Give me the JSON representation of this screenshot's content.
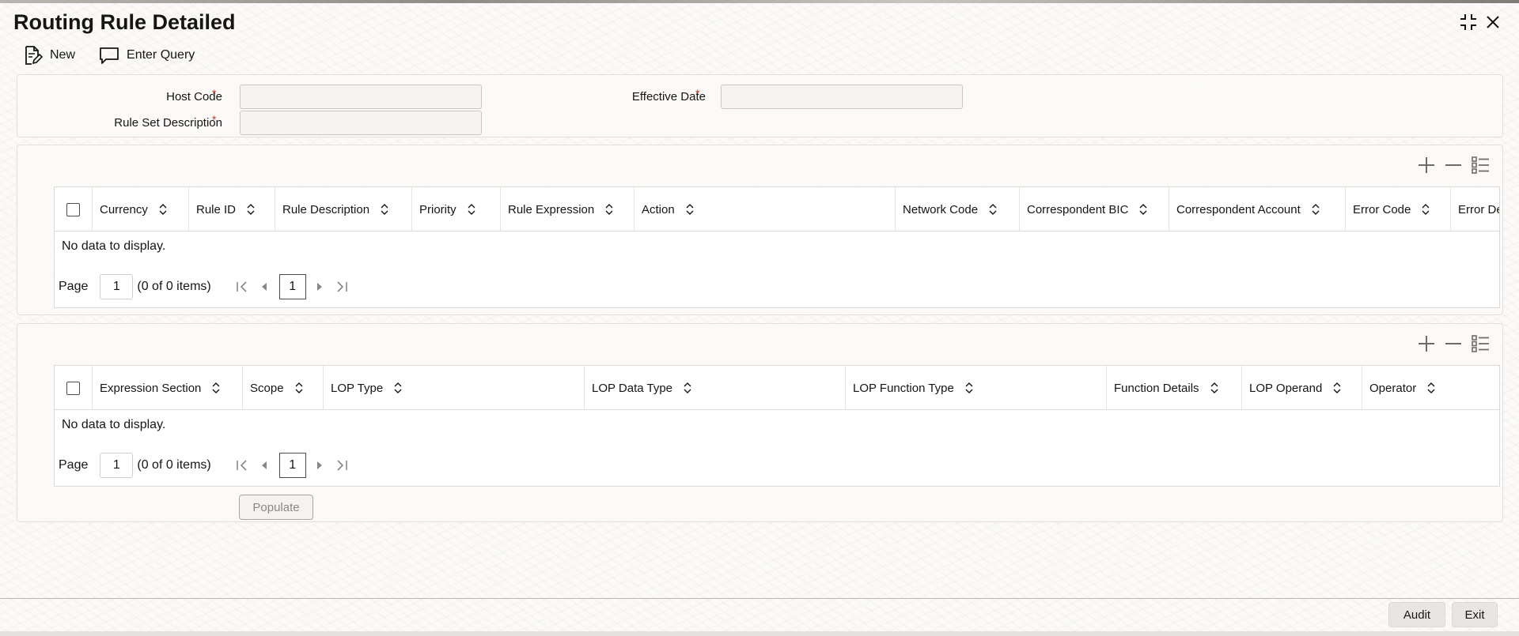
{
  "window": {
    "title": "Routing Rule Detailed",
    "maximize_icon": "maximize-icon",
    "close_icon": "close-icon"
  },
  "toolbar": {
    "new_label": "New",
    "enter_query_label": "Enter Query"
  },
  "form": {
    "host_code_label": "Host Code",
    "host_code_value": "",
    "rule_set_description_label": "Rule Set Description",
    "rule_set_description_value": "",
    "effective_date_label": "Effective Date",
    "effective_date_value": "",
    "required_marker": "*"
  },
  "grid1": {
    "columns": [
      "Currency",
      "Rule ID",
      "Rule Description",
      "Priority",
      "Rule Expression",
      "Action",
      "Network Code",
      "Correspondent BIC",
      "Correspondent Account",
      "Error Code",
      "Error De"
    ],
    "empty_text": "No data to display.",
    "page_label": "Page",
    "page_value": "1",
    "items_text": "(0 of 0 items)",
    "current_page": "1"
  },
  "grid2": {
    "columns": [
      "Expression Section",
      "Scope",
      "LOP Type",
      "LOP Data Type",
      "LOP Function Type",
      "Function Details",
      "LOP Operand",
      "Operator"
    ],
    "empty_text": "No data to display.",
    "page_label": "Page",
    "page_value": "1",
    "items_text": "(0 of 0 items)",
    "current_page": "1",
    "populate_label": "Populate"
  },
  "footer": {
    "audit_label": "Audit",
    "exit_label": "Exit"
  },
  "colors": {
    "required": "#c0392b",
    "text": "#161513",
    "background": "#fbfaf8"
  }
}
